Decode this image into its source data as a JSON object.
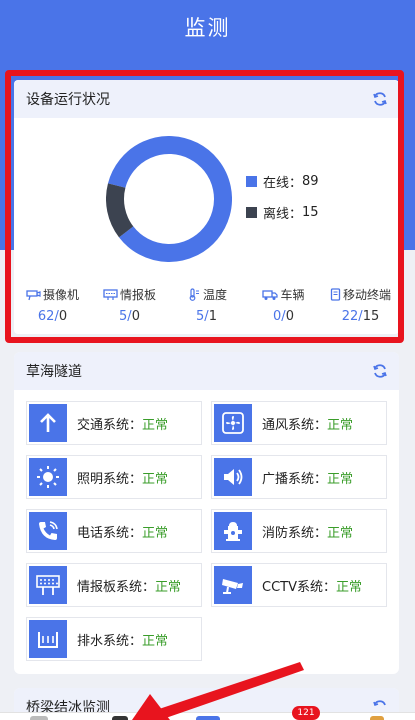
{
  "page": {
    "title": "监测"
  },
  "colors": {
    "primary": "#4a74e8",
    "offline": "#3c4350",
    "ok": "#3a9d2a",
    "highlight": "#e8141e"
  },
  "device_status": {
    "title": "设备运行状况",
    "refresh_icon": "refresh-icon",
    "chart_data": {
      "type": "pie",
      "categories": [
        "在线",
        "离线"
      ],
      "values": [
        89,
        15
      ]
    },
    "legend": [
      {
        "label": "在线：",
        "value": "89",
        "color": "#4a74e8"
      },
      {
        "label": "离线：",
        "value": "15",
        "color": "#3c4350"
      }
    ],
    "devices": [
      {
        "icon": "camera-icon",
        "label": "摄像机",
        "online": "62",
        "offline": "0"
      },
      {
        "icon": "info-board-icon",
        "label": "情报板",
        "online": "5",
        "offline": "0"
      },
      {
        "icon": "thermometer-icon",
        "label": "温度",
        "online": "5",
        "offline": "1"
      },
      {
        "icon": "vehicle-icon",
        "label": "车辆",
        "online": "0",
        "offline": "0"
      },
      {
        "icon": "mobile-terminal-icon",
        "label": "移动终端",
        "online": "22",
        "offline": "15"
      }
    ]
  },
  "tunnel": {
    "title": "草海隧道",
    "systems": [
      {
        "icon": "arrow-up-icon",
        "name": "交通系统：",
        "status": "正常"
      },
      {
        "icon": "fan-icon",
        "name": "通风系统：",
        "status": "正常"
      },
      {
        "icon": "sun-icon",
        "name": "照明系统：",
        "status": "正常"
      },
      {
        "icon": "speaker-icon",
        "name": "广播系统：",
        "status": "正常"
      },
      {
        "icon": "phone-icon",
        "name": "电话系统：",
        "status": "正常"
      },
      {
        "icon": "hydrant-icon",
        "name": "消防系统：",
        "status": "正常"
      },
      {
        "icon": "led-board-icon",
        "name": "情报板系统：",
        "status": "正常"
      },
      {
        "icon": "cctv-camera-icon",
        "name": "CCTV系统：",
        "status": "正常"
      },
      {
        "icon": "drain-icon",
        "name": "排水系统：",
        "status": "正常"
      }
    ]
  },
  "bridge": {
    "title": "桥梁结冰监测"
  },
  "nav": {
    "badge": "121"
  }
}
